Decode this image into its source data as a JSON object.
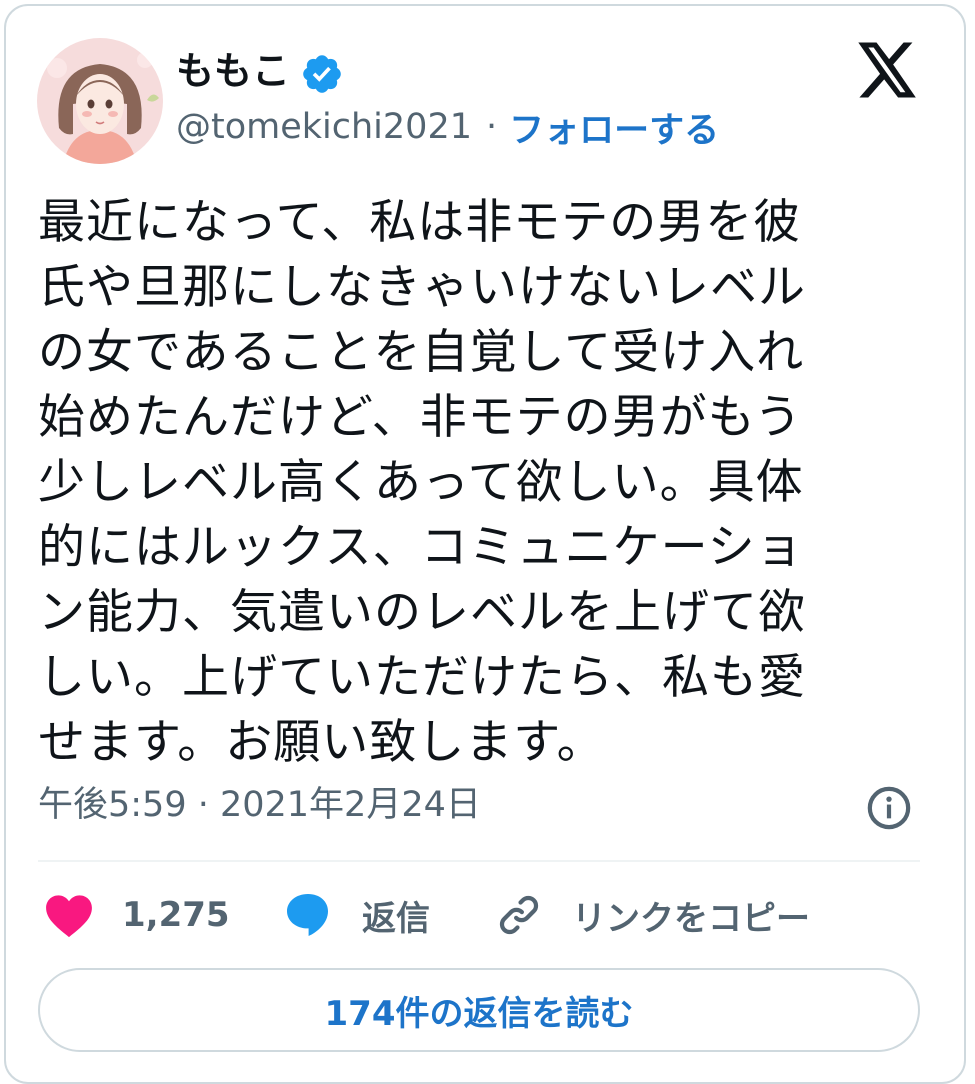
{
  "author": {
    "name": "ももこ",
    "handle": "@tomekichi2021",
    "separator": "·",
    "follow_label": "フォローする",
    "avatar_icon": "avatar-illustration",
    "verified_icon": "verified-badge-icon"
  },
  "tweet": {
    "text": "最近になって、私は非モテの男を彼\n氏や旦那にしなきゃいけないレベル\nの女であることを自覚して受け入れ\n始めたんだけど、非モテの男がもう\n少しレベル高くあって欲しい。具体\n的にはルックス、コミュニケーショ\nン能力、気遣いのレベルを上げて欲\nしい。上げていただけたら、私も愛\nせます。お願い致します。",
    "timestamp": "午後5:59 · 2021年2月24日"
  },
  "actions": {
    "like_count": "1,275",
    "reply_label": "返信",
    "copy_link_label": "リンクをコピー"
  },
  "read_replies_label": "174件の返信を読む",
  "colors": {
    "accent": "#1d74c9",
    "verified": "#1d9bf0",
    "heart": "#f91880",
    "muted_text": "#536471",
    "border": "#cfd9de"
  }
}
